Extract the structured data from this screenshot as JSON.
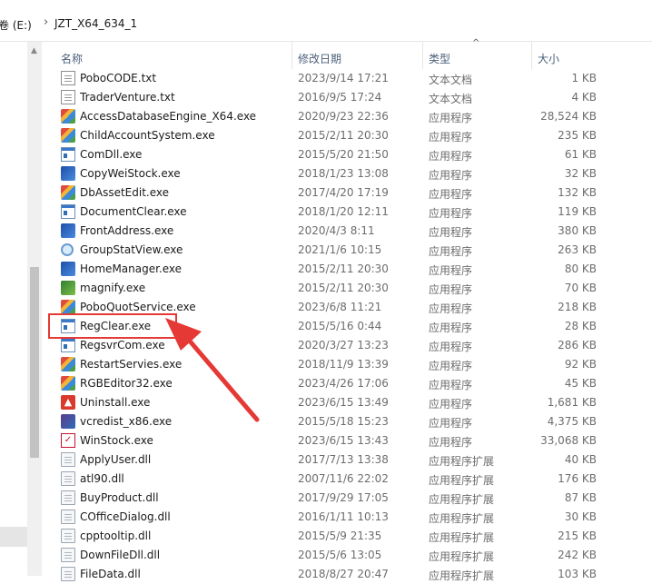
{
  "breadcrumb": {
    "drive": "卷 (E:)",
    "folder": "JZT_X64_634_1"
  },
  "columns": {
    "name": "名称",
    "date": "修改日期",
    "type": "类型",
    "size": "大小"
  },
  "files": [
    {
      "name": "PoboCODE.txt",
      "date": "2023/9/14 17:21",
      "type": "文本文档",
      "size": "1 KB",
      "icon": "text-file-icon"
    },
    {
      "name": "TraderVenture.txt",
      "date": "2016/9/5 17:24",
      "type": "文本文档",
      "size": "4 KB",
      "icon": "text-file-icon"
    },
    {
      "name": "AccessDatabaseEngine_X64.exe",
      "date": "2020/9/23 22:36",
      "type": "应用程序",
      "size": "28,524 KB",
      "icon": "installer-icon"
    },
    {
      "name": "ChildAccountSystem.exe",
      "date": "2015/2/11 20:30",
      "type": "应用程序",
      "size": "235 KB",
      "icon": "app-multicolor-icon"
    },
    {
      "name": "ComDll.exe",
      "date": "2015/5/20 21:50",
      "type": "应用程序",
      "size": "61 KB",
      "icon": "window-app-icon"
    },
    {
      "name": "CopyWeiStock.exe",
      "date": "2018/1/23 13:08",
      "type": "应用程序",
      "size": "32 KB",
      "icon": "app-blue-icon"
    },
    {
      "name": "DbAssetEdit.exe",
      "date": "2017/4/20 17:19",
      "type": "应用程序",
      "size": "132 KB",
      "icon": "app-multicolor-icon"
    },
    {
      "name": "DocumentClear.exe",
      "date": "2018/1/20 12:11",
      "type": "应用程序",
      "size": "119 KB",
      "icon": "window-app-icon"
    },
    {
      "name": "FrontAddress.exe",
      "date": "2020/4/3 8:11",
      "type": "应用程序",
      "size": "380 KB",
      "icon": "app-blue-icon"
    },
    {
      "name": "GroupStatView.exe",
      "date": "2021/1/6 10:15",
      "type": "应用程序",
      "size": "263 KB",
      "icon": "magnifier-icon"
    },
    {
      "name": "HomeManager.exe",
      "date": "2015/2/11 20:30",
      "type": "应用程序",
      "size": "80 KB",
      "icon": "app-blue-icon"
    },
    {
      "name": "magnify.exe",
      "date": "2015/2/11 20:30",
      "type": "应用程序",
      "size": "70 KB",
      "icon": "app-green-icon"
    },
    {
      "name": "PoboQuotService.exe",
      "date": "2023/6/8 11:21",
      "type": "应用程序",
      "size": "218 KB",
      "icon": "app-multicolor-icon"
    },
    {
      "name": "RegClear.exe",
      "date": "2015/5/16 0:44",
      "type": "应用程序",
      "size": "28 KB",
      "icon": "window-app-icon"
    },
    {
      "name": "RegsvrCom.exe",
      "date": "2020/3/27 13:23",
      "type": "应用程序",
      "size": "286 KB",
      "icon": "window-app-icon"
    },
    {
      "name": "RestartServies.exe",
      "date": "2018/11/9 13:39",
      "type": "应用程序",
      "size": "92 KB",
      "icon": "app-multicolor-icon"
    },
    {
      "name": "RGBEditor32.exe",
      "date": "2023/4/26 17:06",
      "type": "应用程序",
      "size": "45 KB",
      "icon": "app-multicolor-icon"
    },
    {
      "name": "Uninstall.exe",
      "date": "2023/6/15 13:49",
      "type": "应用程序",
      "size": "1,681 KB",
      "icon": "uninstall-icon"
    },
    {
      "name": "vcredist_x86.exe",
      "date": "2015/5/18 15:23",
      "type": "应用程序",
      "size": "4,375 KB",
      "icon": "vc-installer-icon"
    },
    {
      "name": "WinStock.exe",
      "date": "2023/6/15 13:43",
      "type": "应用程序",
      "size": "33,068 KB",
      "icon": "winstock-icon"
    },
    {
      "name": "ApplyUser.dll",
      "date": "2017/7/13 13:38",
      "type": "应用程序扩展",
      "size": "40 KB",
      "icon": "dll-file-icon"
    },
    {
      "name": "atl90.dll",
      "date": "2007/11/6 22:02",
      "type": "应用程序扩展",
      "size": "176 KB",
      "icon": "dll-file-icon"
    },
    {
      "name": "BuyProduct.dll",
      "date": "2017/9/29 17:05",
      "type": "应用程序扩展",
      "size": "87 KB",
      "icon": "dll-file-icon"
    },
    {
      "name": "COfficeDialog.dll",
      "date": "2016/1/11 10:13",
      "type": "应用程序扩展",
      "size": "30 KB",
      "icon": "dll-file-icon"
    },
    {
      "name": "cpptooltip.dll",
      "date": "2015/5/9 21:35",
      "type": "应用程序扩展",
      "size": "215 KB",
      "icon": "dll-file-icon"
    },
    {
      "name": "DownFileDll.dll",
      "date": "2015/5/6 13:05",
      "type": "应用程序扩展",
      "size": "242 KB",
      "icon": "dll-file-icon"
    },
    {
      "name": "FileData.dll",
      "date": "2018/8/27 20:47",
      "type": "应用程序扩展",
      "size": "103 KB",
      "icon": "dll-file-icon"
    }
  ],
  "colors": {
    "highlight": "#e53935",
    "header_text": "#4c607a"
  }
}
